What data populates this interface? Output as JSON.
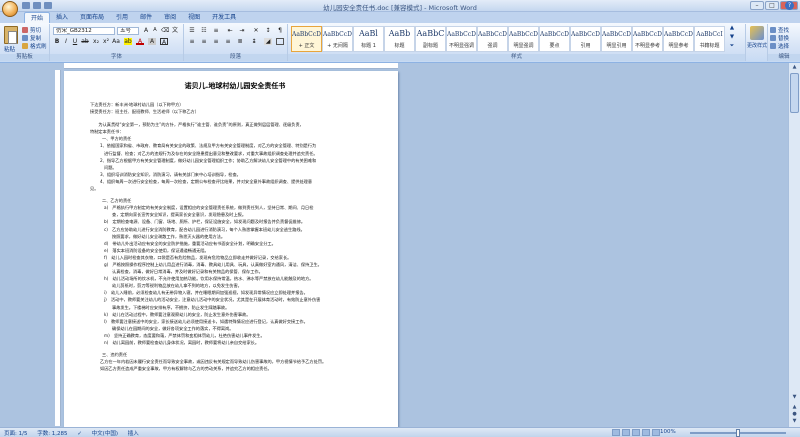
{
  "window": {
    "title": "幼儿园安全责任书.doc [兼容模式] - Microsoft Word"
  },
  "tabs": [
    "开始",
    "插入",
    "页面布局",
    "引用",
    "邮件",
    "审阅",
    "视图",
    "开发工具"
  ],
  "ribbon": {
    "clipboard": {
      "paste": "粘贴",
      "cut": "剪切",
      "copy": "复制",
      "format_painter": "格式刷",
      "label": "剪贴板"
    },
    "font": {
      "name": "仿宋_GB2312",
      "size": "五号",
      "label": "字体"
    },
    "paragraph": {
      "label": "段落"
    },
    "styles": {
      "items": [
        {
          "preview": "AaBbCcDc",
          "name": "+ 正文",
          "selected": true
        },
        {
          "preview": "AaBbCcDc",
          "name": "+ 无间隔",
          "selected": false
        },
        {
          "preview": "AaBl",
          "name": "标题 1",
          "selected": false
        },
        {
          "preview": "AaBb",
          "name": "标题",
          "selected": false
        },
        {
          "preview": "AaBbC",
          "name": "副标题",
          "selected": false
        },
        {
          "preview": "AaBbCcDc",
          "name": "不明显强调",
          "selected": false
        },
        {
          "preview": "AaBbCcDc",
          "name": "强调",
          "selected": false
        },
        {
          "preview": "AaBbCcDc",
          "name": "明显强调",
          "selected": false
        },
        {
          "preview": "AaBbCcDc",
          "name": "要点",
          "selected": false
        },
        {
          "preview": "AaBbCcDc",
          "name": "引用",
          "selected": false
        },
        {
          "preview": "AaBbCcDc",
          "name": "明显引用",
          "selected": false
        },
        {
          "preview": "AaBbCcDc",
          "name": "不明显参考",
          "selected": false
        },
        {
          "preview": "AaBbCcDc",
          "name": "明显参考",
          "selected": false
        },
        {
          "preview": "AaBbCcI",
          "name": "书籍标题",
          "selected": false
        }
      ],
      "change_styles": "更改样式",
      "label": "样式"
    },
    "editing": {
      "find": "查找",
      "replace": "替换",
      "select": "选择",
      "label": "编辑"
    }
  },
  "document": {
    "title": "诺贝儿.地球村幼儿园安全责任书",
    "paragraphs": [
      {
        "cls": "gap",
        "text": "下达责任方：新丰洲·地球村幼儿园（以下称甲方）"
      },
      {
        "cls": "",
        "text": "接受责任方：班主任、配班教师、生活老师（以下称乙方）"
      },
      {
        "cls": "gap",
        "text": "　　为认真贯彻“安全第一，预防为主”的方针，严格执行“谁主管、谁负责”的原则，真正做到层层管理、逐级负责，"
      },
      {
        "cls": "",
        "text": "特制定本责任书："
      },
      {
        "cls": "sec",
        "text": "一、甲方的责任"
      },
      {
        "cls": "num",
        "text": "1、依据国家和省、市政府、教育局有关安全的政策、法规及甲方有关安全管理制度，对乙方的安全管理、特别是行为"
      },
      {
        "cls": "wrap",
        "text": "进行监督、检查；对乙方的违规行为及存在的安全隐患提出意见和整改要求，对重大事故组织调查处理并追究责任。"
      },
      {
        "cls": "num",
        "text": "2、指导乙方根据甲方有关安全管理制度，做好幼儿园安全管理组织工作；协助乙方解决幼儿安全管理中的有关困难和"
      },
      {
        "cls": "wrap",
        "text": "问题。"
      },
      {
        "cls": "num",
        "text": "3、组织培训消防安全知识，消防演习，请有关部门来中心培训指导，检查。"
      },
      {
        "cls": "num",
        "text": "4、组织每周一次进行安全检查，每周一次检查，定期公布检查评比结果，并对安全意外事故组织调查、提供处理意"
      },
      {
        "cls": "",
        "text": "见。"
      },
      {
        "cls": "sec gap2",
        "text": "二、乙方的责任"
      },
      {
        "cls": "sub",
        "text": "a)　严格执行甲方制定的有关安全制度，设置相应的安全管理责任系统，做到责任到人，坚持日常、期间、月日检"
      },
      {
        "cls": "subwrap",
        "text": "查，定期向家长宣传安全知识，提高家长安全意识，发现隐患及时上报。"
      },
      {
        "cls": "sub",
        "text": "b)　定期检查电源、设备、门窗、场地、厕所、护栏，保证设施安全，如发现问题及时报告并负责督促维修。"
      },
      {
        "cls": "sub",
        "text": "c)　乙方应协助幼儿进行安全消防教育，配合幼儿园进行消防演习，每个人熟悉掌握本班幼儿安全逃生路线。"
      },
      {
        "cls": "subwrap",
        "text": "按照要求，做好幼儿安全疏散工作，熟悉灭火器的使用方法。"
      },
      {
        "cls": "sub",
        "text": "d)　带幼儿外出活动应有安全的安全防护措施，重要活动应有书面安全计划，明确安全分工。"
      },
      {
        "cls": "sub",
        "text": "e)　落实本班消防设备的安全使用，保证通道畅通无阻。"
      },
      {
        "cls": "sub",
        "text": "f)　幼儿入园时检查其衣物，口袋是否有危险物品，发现有危险物品立即收走并做好记录，交给家长。"
      },
      {
        "cls": "sub",
        "text": "g)　严格按照操作程序控制上幼儿用品进行消毒，消毒、教具幼儿用具、玩具，认真做好室内通风，清洁、保持卫生。"
      },
      {
        "cls": "subwrap",
        "text": "认真检查，消毒，做好日常消毒，并及时做好记录和有关物品的保管、保存工作。"
      },
      {
        "cls": "sub",
        "text": "h)　幼儿活动场所的饮水机，不允许使用加热功能。饮用水保持常温，热水、沸水等严禁放在幼儿能触及的地方。"
      },
      {
        "cls": "subwrap",
        "text": "幼儿剪纸时，剪刀等锐利物品放在幼儿拿不到的地方，以免发生伤害。"
      },
      {
        "cls": "sub",
        "text": "i)　幼儿入睡前，必须检查幼儿有无带异物入寝，并在睡眠期间加强巡视，如发现异常情况应立即处理并报告。"
      },
      {
        "cls": "sub",
        "text": "j)　活动中，教师要关注幼儿的活动安全，注意幼儿活动中的安全状况，尤其是在开展体育活动时，有效防止意外伤害"
      },
      {
        "cls": "subwrap",
        "text": "事故发生。下楼梯时应安排有序，不拥挤，防止发生踩踏事故。"
      },
      {
        "cls": "sub",
        "text": "k)　幼儿在活动过程中，教师要注意观察幼儿的安全，防止发生意外伤害事故。"
      },
      {
        "cls": "sub",
        "text": "l)　教师要注意接送中的安全，家长接送幼儿必须使用接送卡，如遇特殊情况应进行登记，认真做好交接工作。"
      },
      {
        "cls": "subwrap",
        "text": "确保幼儿在园期间的安全，做好各项安全工作的落实，不得离岗。"
      },
      {
        "cls": "sub",
        "text": "m)　坚持正确教育，态度要和蔼，严禁体罚和变相体罚幼儿，杜绝伤害幼儿事件发生。"
      },
      {
        "cls": "sub",
        "text": "n)　幼儿离园前，教师要检查幼儿身体状况，离园时，教师要将幼儿亲自交给家长。"
      },
      {
        "cls": "sec gap2",
        "text": "三、违约责任"
      },
      {
        "cls": "num",
        "text": "乙方在一年内若因未履行安全责任而导致安全事故，或因违反有关规定而导致幼儿伤害事故的，甲方视情节给予乙方处罚。"
      },
      {
        "cls": "num",
        "text": "如因乙方责任造成严重安全事故，甲方有权解除与乙方的劳动关系，并追究乙方的相应责任。"
      }
    ]
  },
  "status": {
    "page": "页面: 1/5",
    "words": "字数: 1,285",
    "language": "中文(中国)",
    "mode": "插入"
  },
  "zoom": {
    "label": "100%"
  }
}
